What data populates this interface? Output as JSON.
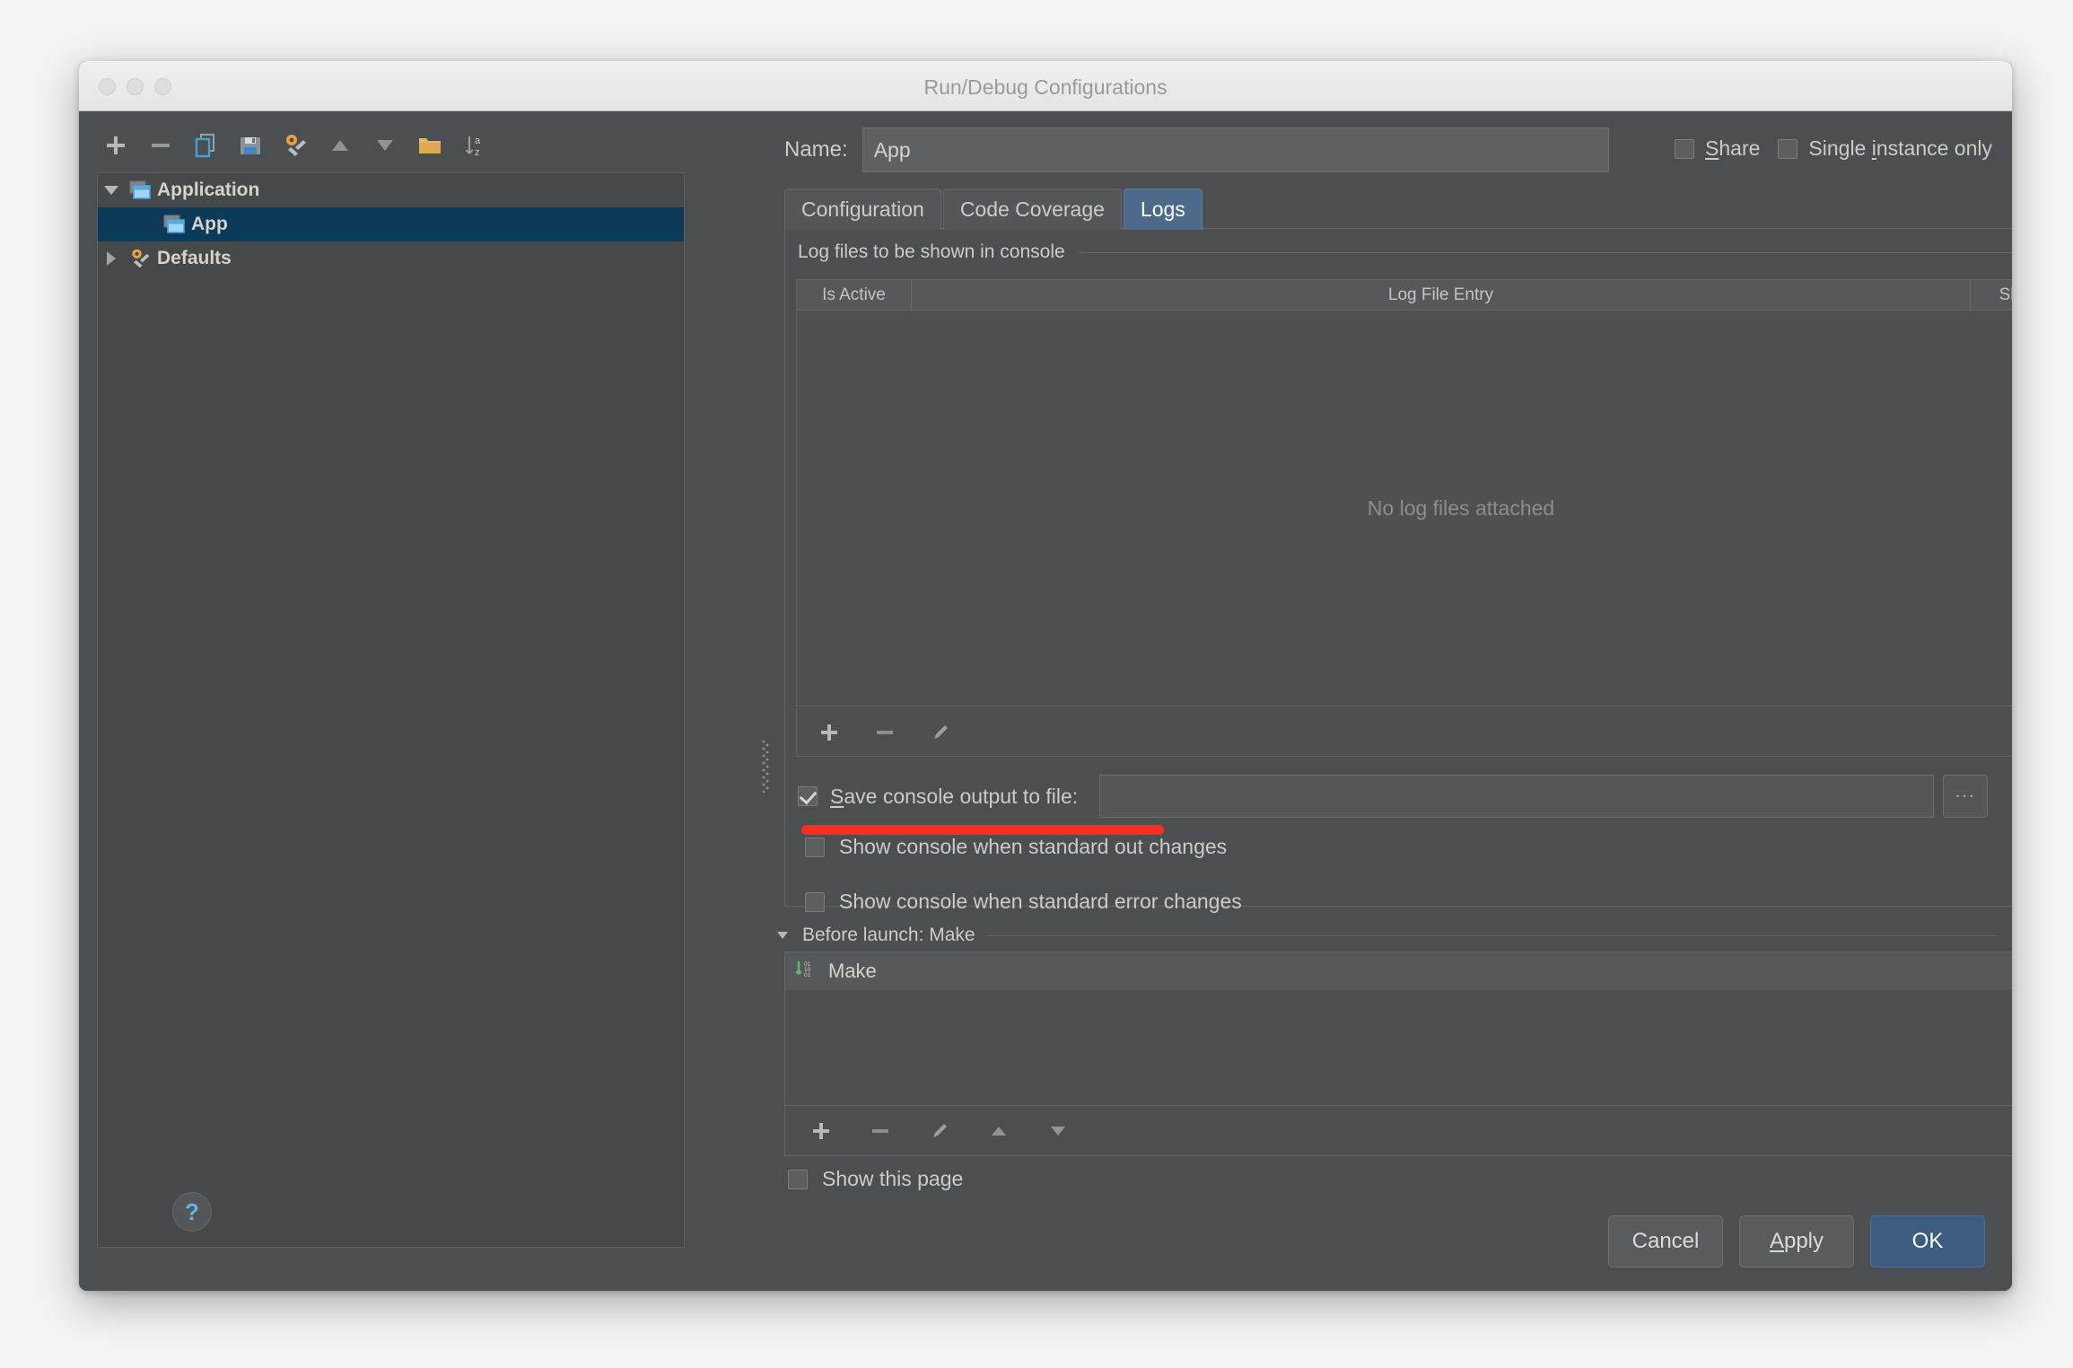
{
  "window": {
    "title": "Run/Debug Configurations",
    "traffic_lights": [
      "close-button",
      "minimize-button",
      "zoom-button"
    ]
  },
  "toolbar": {
    "buttons": [
      {
        "name": "add-configuration",
        "icon": "plus-icon"
      },
      {
        "name": "remove-configuration",
        "icon": "minus-icon"
      },
      {
        "name": "copy-configuration",
        "icon": "copy-icon"
      },
      {
        "name": "save-configuration",
        "icon": "save-floppy-icon"
      },
      {
        "name": "edit-defaults",
        "icon": "wrench-gear-icon"
      },
      {
        "name": "move-up",
        "icon": "arrow-up-icon"
      },
      {
        "name": "move-down",
        "icon": "arrow-down-icon"
      },
      {
        "name": "create-folder",
        "icon": "folder-icon"
      },
      {
        "name": "sort-alphabetically",
        "icon": "sort-az-icon"
      }
    ]
  },
  "tree": {
    "nodes": [
      {
        "label": "Application",
        "icon": "application-icon",
        "expanded": true,
        "selected": false,
        "level": 0
      },
      {
        "label": "App",
        "icon": "application-icon",
        "expanded": null,
        "selected": true,
        "level": 1
      },
      {
        "label": "Defaults",
        "icon": "wrench-gear-icon",
        "expanded": false,
        "selected": false,
        "level": 0
      }
    ]
  },
  "name_field": {
    "label": "Name:",
    "value": "App",
    "placeholder": ""
  },
  "top_checks": [
    {
      "label": "Share",
      "checked": false,
      "mnemonic": "S"
    },
    {
      "label": "Single instance only",
      "checked": false,
      "mnemonic": "i"
    }
  ],
  "tabs": [
    {
      "label": "Configuration",
      "active": false
    },
    {
      "label": "Code Coverage",
      "active": false
    },
    {
      "label": "Logs",
      "active": true
    }
  ],
  "logs": {
    "section_title": "Log files to be shown in console",
    "columns": [
      "Is Active",
      "Log File Entry",
      "Skip Content"
    ],
    "rows": [],
    "empty_text": "No log files attached",
    "toolbar": [
      {
        "name": "add-log-file",
        "icon": "plus-icon"
      },
      {
        "name": "remove-log-file",
        "icon": "minus-icon"
      },
      {
        "name": "edit-log-file",
        "icon": "pencil-icon"
      }
    ]
  },
  "save_output": {
    "label": "Save console output to file:",
    "mnemonic": "S",
    "checked": true,
    "path_value": "",
    "path_placeholder": "",
    "browse_label": "...",
    "highlight_color": "#f92d20"
  },
  "console_options": [
    {
      "label": "Show console when standard out changes",
      "checked": false
    },
    {
      "label": "Show console when standard error changes",
      "checked": false
    }
  ],
  "before_launch": {
    "title": "Before launch: Make",
    "expanded": true,
    "tasks": [
      {
        "label": "Make",
        "icon": "make-build-icon"
      }
    ],
    "toolbar": [
      {
        "name": "add-task",
        "icon": "plus-icon"
      },
      {
        "name": "remove-task",
        "icon": "minus-icon"
      },
      {
        "name": "edit-task",
        "icon": "pencil-icon"
      },
      {
        "name": "move-task-up",
        "icon": "arrow-up-icon"
      },
      {
        "name": "move-task-down",
        "icon": "arrow-down-icon"
      }
    ],
    "show_page": {
      "label": "Show this page",
      "checked": false
    }
  },
  "footer": {
    "help_label": "?",
    "buttons": [
      {
        "label": "Cancel",
        "primary": false
      },
      {
        "label": "Apply",
        "primary": false,
        "mnemonic": "A"
      },
      {
        "label": "OK",
        "primary": true
      }
    ]
  }
}
